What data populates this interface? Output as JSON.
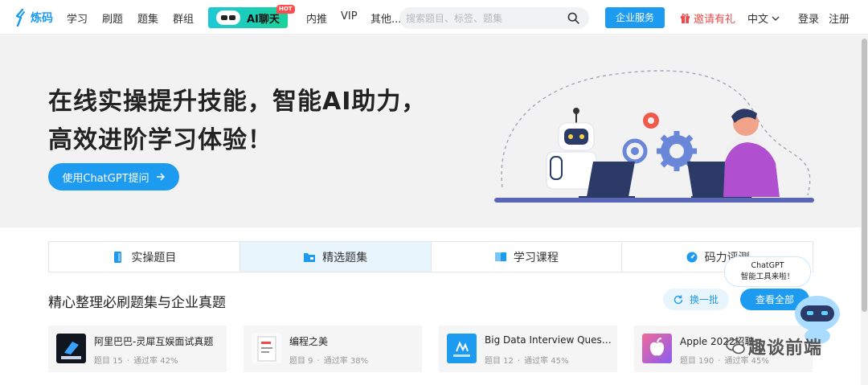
{
  "nav": {
    "logo_text": "炼码",
    "items": [
      "学习",
      "刷题",
      "题集",
      "群组"
    ],
    "ai_chat_label": "AI聊天",
    "hot_tag": "HOT",
    "items2": [
      "内推",
      "VIP",
      "其他..."
    ],
    "search_placeholder": "搜索题目、标签、题集",
    "enterprise_label": "企业服务",
    "invite_label": "邀请有礼",
    "language": "中文",
    "login": "登录",
    "register": "注册"
  },
  "hero": {
    "line1": "在线实操提升技能，智能AI助力，",
    "line2": "高效进阶学习体验！",
    "cta_label": "使用ChatGPT提问"
  },
  "tabs": [
    {
      "label": "实操题目",
      "icon": "phone-icon"
    },
    {
      "label": "精选题集",
      "icon": "folder-icon"
    },
    {
      "label": "学习课程",
      "icon": "book-icon"
    },
    {
      "label": "码力评测",
      "icon": "gauge-icon"
    }
  ],
  "section": {
    "title": "精心整理必刷题集与企业真题",
    "refresh_label": "换一批",
    "view_all_label": "查看全部"
  },
  "cards": [
    {
      "title": "阿里巴巴-灵犀互娱面试真题",
      "count_label": "题目 15",
      "rate_label": "通过率 42%"
    },
    {
      "title": "编程之美",
      "count_label": "题目 9",
      "rate_label": "通过率 38%"
    },
    {
      "title": "Big Data Interview Questions",
      "count_label": "题目 12",
      "rate_label": "通过率 45%"
    },
    {
      "title": "Apple 2022招聘",
      "count_label": "题目 190",
      "rate_label": "通过率 45%"
    }
  ],
  "float": {
    "line1": "ChatGPT",
    "line2": "智能工具来啦！"
  },
  "watermark": "趣谈前端",
  "colors": {
    "brand_blue": "#1d9bf0",
    "ai_gradient_start": "#1ec8d6",
    "ai_gradient_end": "#19d29a",
    "invite_red": "#ef4a4a",
    "hero_bg": "#f2f2f2"
  }
}
